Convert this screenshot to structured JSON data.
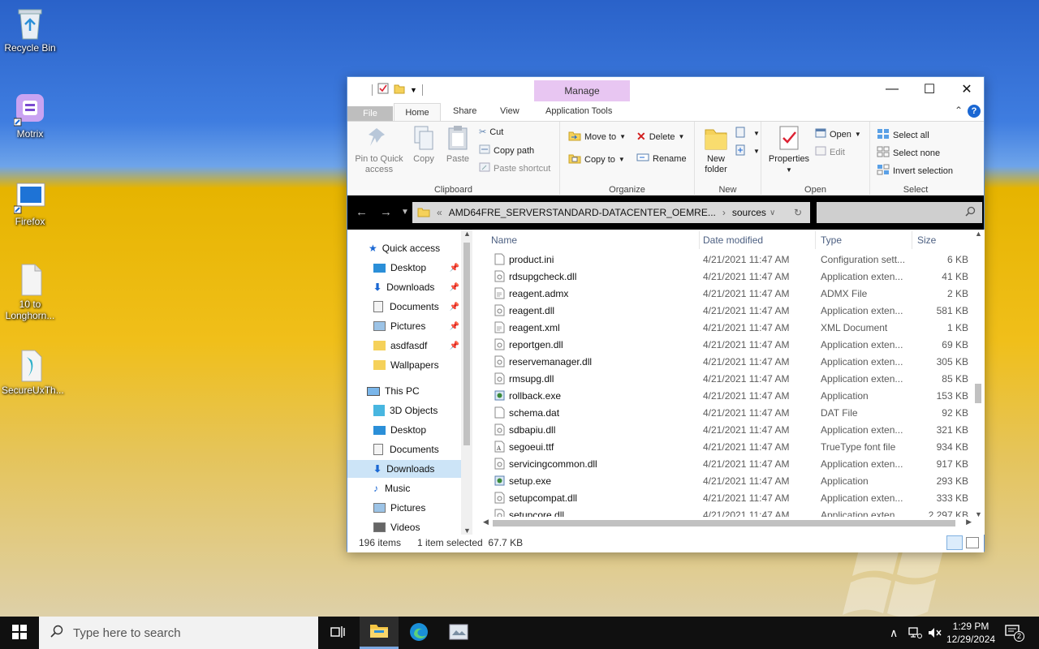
{
  "desktop": {
    "icons": [
      {
        "label": "Recycle Bin"
      },
      {
        "label": "Motrix"
      },
      {
        "label": "Firefox"
      },
      {
        "label": "10 to Longhorn..."
      },
      {
        "label": "SecureUxTh..."
      }
    ]
  },
  "window": {
    "contextual_tab": "Manage",
    "controls": {
      "minimize": "—",
      "maximize": "☐",
      "close": "✕"
    },
    "ribbon_tabs": [
      "File",
      "Home",
      "Share",
      "View",
      "Application Tools"
    ],
    "ribbon": {
      "clipboard": {
        "label": "Clipboard",
        "pin": "Pin to Quick access",
        "copy": "Copy",
        "paste": "Paste",
        "cut": "Cut",
        "copy_path": "Copy path",
        "paste_shortcut": "Paste shortcut"
      },
      "organize": {
        "label": "Organize",
        "move_to": "Move to",
        "copy_to": "Copy to",
        "delete": "Delete",
        "rename": "Rename"
      },
      "new": {
        "label": "New",
        "new_folder": "New folder"
      },
      "open": {
        "label": "Open",
        "properties": "Properties",
        "open": "Open",
        "edit": "Edit"
      },
      "select": {
        "label": "Select",
        "select_all": "Select all",
        "select_none": "Select none",
        "invert": "Invert selection"
      }
    },
    "address": {
      "prefix": "«",
      "path_1": "AMD64FRE_SERVERSTANDARD-DATACENTER_OEMRE...",
      "sep": "›",
      "path_2": "sources"
    },
    "nav": {
      "quick_access": "Quick access",
      "quick_items": [
        "Desktop",
        "Downloads",
        "Documents",
        "Pictures",
        "asdfasdf",
        "Wallpapers"
      ],
      "this_pc": "This PC",
      "pc_items": [
        "3D Objects",
        "Desktop",
        "Documents",
        "Downloads",
        "Music",
        "Pictures",
        "Videos"
      ]
    },
    "columns": {
      "name": "Name",
      "date": "Date modified",
      "type": "Type",
      "size": "Size"
    },
    "files": [
      {
        "name": "product.ini",
        "date": "4/21/2021 11:47 AM",
        "type": "Configuration sett...",
        "size": "6 KB"
      },
      {
        "name": "rdsupgcheck.dll",
        "date": "4/21/2021 11:47 AM",
        "type": "Application exten...",
        "size": "41 KB"
      },
      {
        "name": "reagent.admx",
        "date": "4/21/2021 11:47 AM",
        "type": "ADMX File",
        "size": "2 KB"
      },
      {
        "name": "reagent.dll",
        "date": "4/21/2021 11:47 AM",
        "type": "Application exten...",
        "size": "581 KB"
      },
      {
        "name": "reagent.xml",
        "date": "4/21/2021 11:47 AM",
        "type": "XML Document",
        "size": "1 KB"
      },
      {
        "name": "reportgen.dll",
        "date": "4/21/2021 11:47 AM",
        "type": "Application exten...",
        "size": "69 KB"
      },
      {
        "name": "reservemanager.dll",
        "date": "4/21/2021 11:47 AM",
        "type": "Application exten...",
        "size": "305 KB"
      },
      {
        "name": "rmsupg.dll",
        "date": "4/21/2021 11:47 AM",
        "type": "Application exten...",
        "size": "85 KB"
      },
      {
        "name": "rollback.exe",
        "date": "4/21/2021 11:47 AM",
        "type": "Application",
        "size": "153 KB"
      },
      {
        "name": "schema.dat",
        "date": "4/21/2021 11:47 AM",
        "type": "DAT File",
        "size": "92 KB"
      },
      {
        "name": "sdbapiu.dll",
        "date": "4/21/2021 11:47 AM",
        "type": "Application exten...",
        "size": "321 KB"
      },
      {
        "name": "segoeui.ttf",
        "date": "4/21/2021 11:47 AM",
        "type": "TrueType font file",
        "size": "934 KB"
      },
      {
        "name": "servicingcommon.dll",
        "date": "4/21/2021 11:47 AM",
        "type": "Application exten...",
        "size": "917 KB"
      },
      {
        "name": "setup.exe",
        "date": "4/21/2021 11:47 AM",
        "type": "Application",
        "size": "293 KB"
      },
      {
        "name": "setupcompat.dll",
        "date": "4/21/2021 11:47 AM",
        "type": "Application exten...",
        "size": "333 KB"
      },
      {
        "name": "setupcore.dll",
        "date": "4/21/2021 11:47 AM",
        "type": "Application exten...",
        "size": "2,297 KB"
      }
    ],
    "status": {
      "count": "196 items",
      "selected": "1 item selected  67.7 KB"
    }
  },
  "taskbar": {
    "search_placeholder": "Type here to search",
    "time": "1:29 PM",
    "date": "12/29/2024",
    "notifications": "2"
  },
  "colors": {
    "accent": "#1a67d3",
    "manage_tab": "#e8c6f2",
    "selection": "#cce4f7"
  }
}
